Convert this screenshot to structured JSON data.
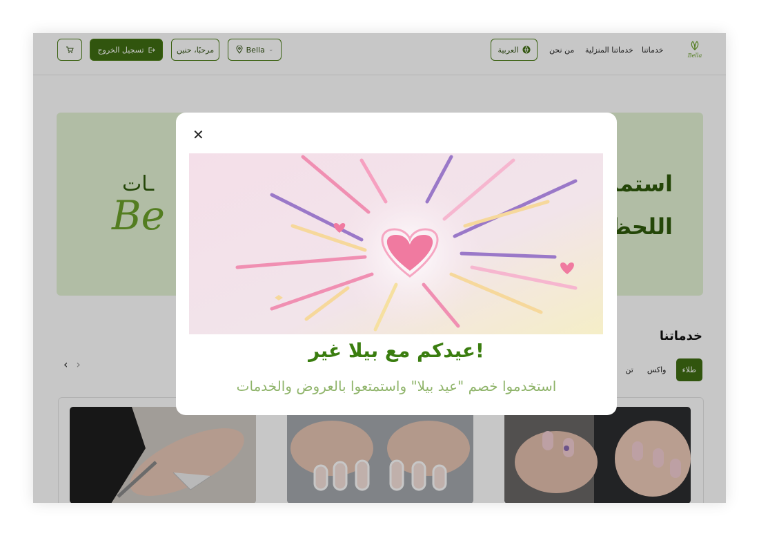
{
  "header": {
    "logo_text": "Bella",
    "nav": [
      "خدماتنا",
      "خدماتنا المنزلية",
      "من نحن"
    ],
    "language_label": "العربية",
    "location_label": "Bella",
    "greeting_label": "مرحبًا، حنين",
    "logout_label": "تسجيل الخروج"
  },
  "hero": {
    "line1": "استمت",
    "line2": "اللحظ",
    "word_left": "ـات",
    "brand": "Be"
  },
  "services": {
    "title": "خدماتنا",
    "tabs": [
      "طلاء",
      "واكس",
      "تن"
    ]
  },
  "modal": {
    "title": "عيدكم مع بيلا غير!",
    "subtitle": "استخدموا خصم \"عيد بيلا\" واستمتعوا بالعروض والخدمات"
  },
  "colors": {
    "brand_green": "#3f6e12",
    "hero_bg": "#e3f3d4",
    "subtitle_green": "#8fb46a"
  }
}
